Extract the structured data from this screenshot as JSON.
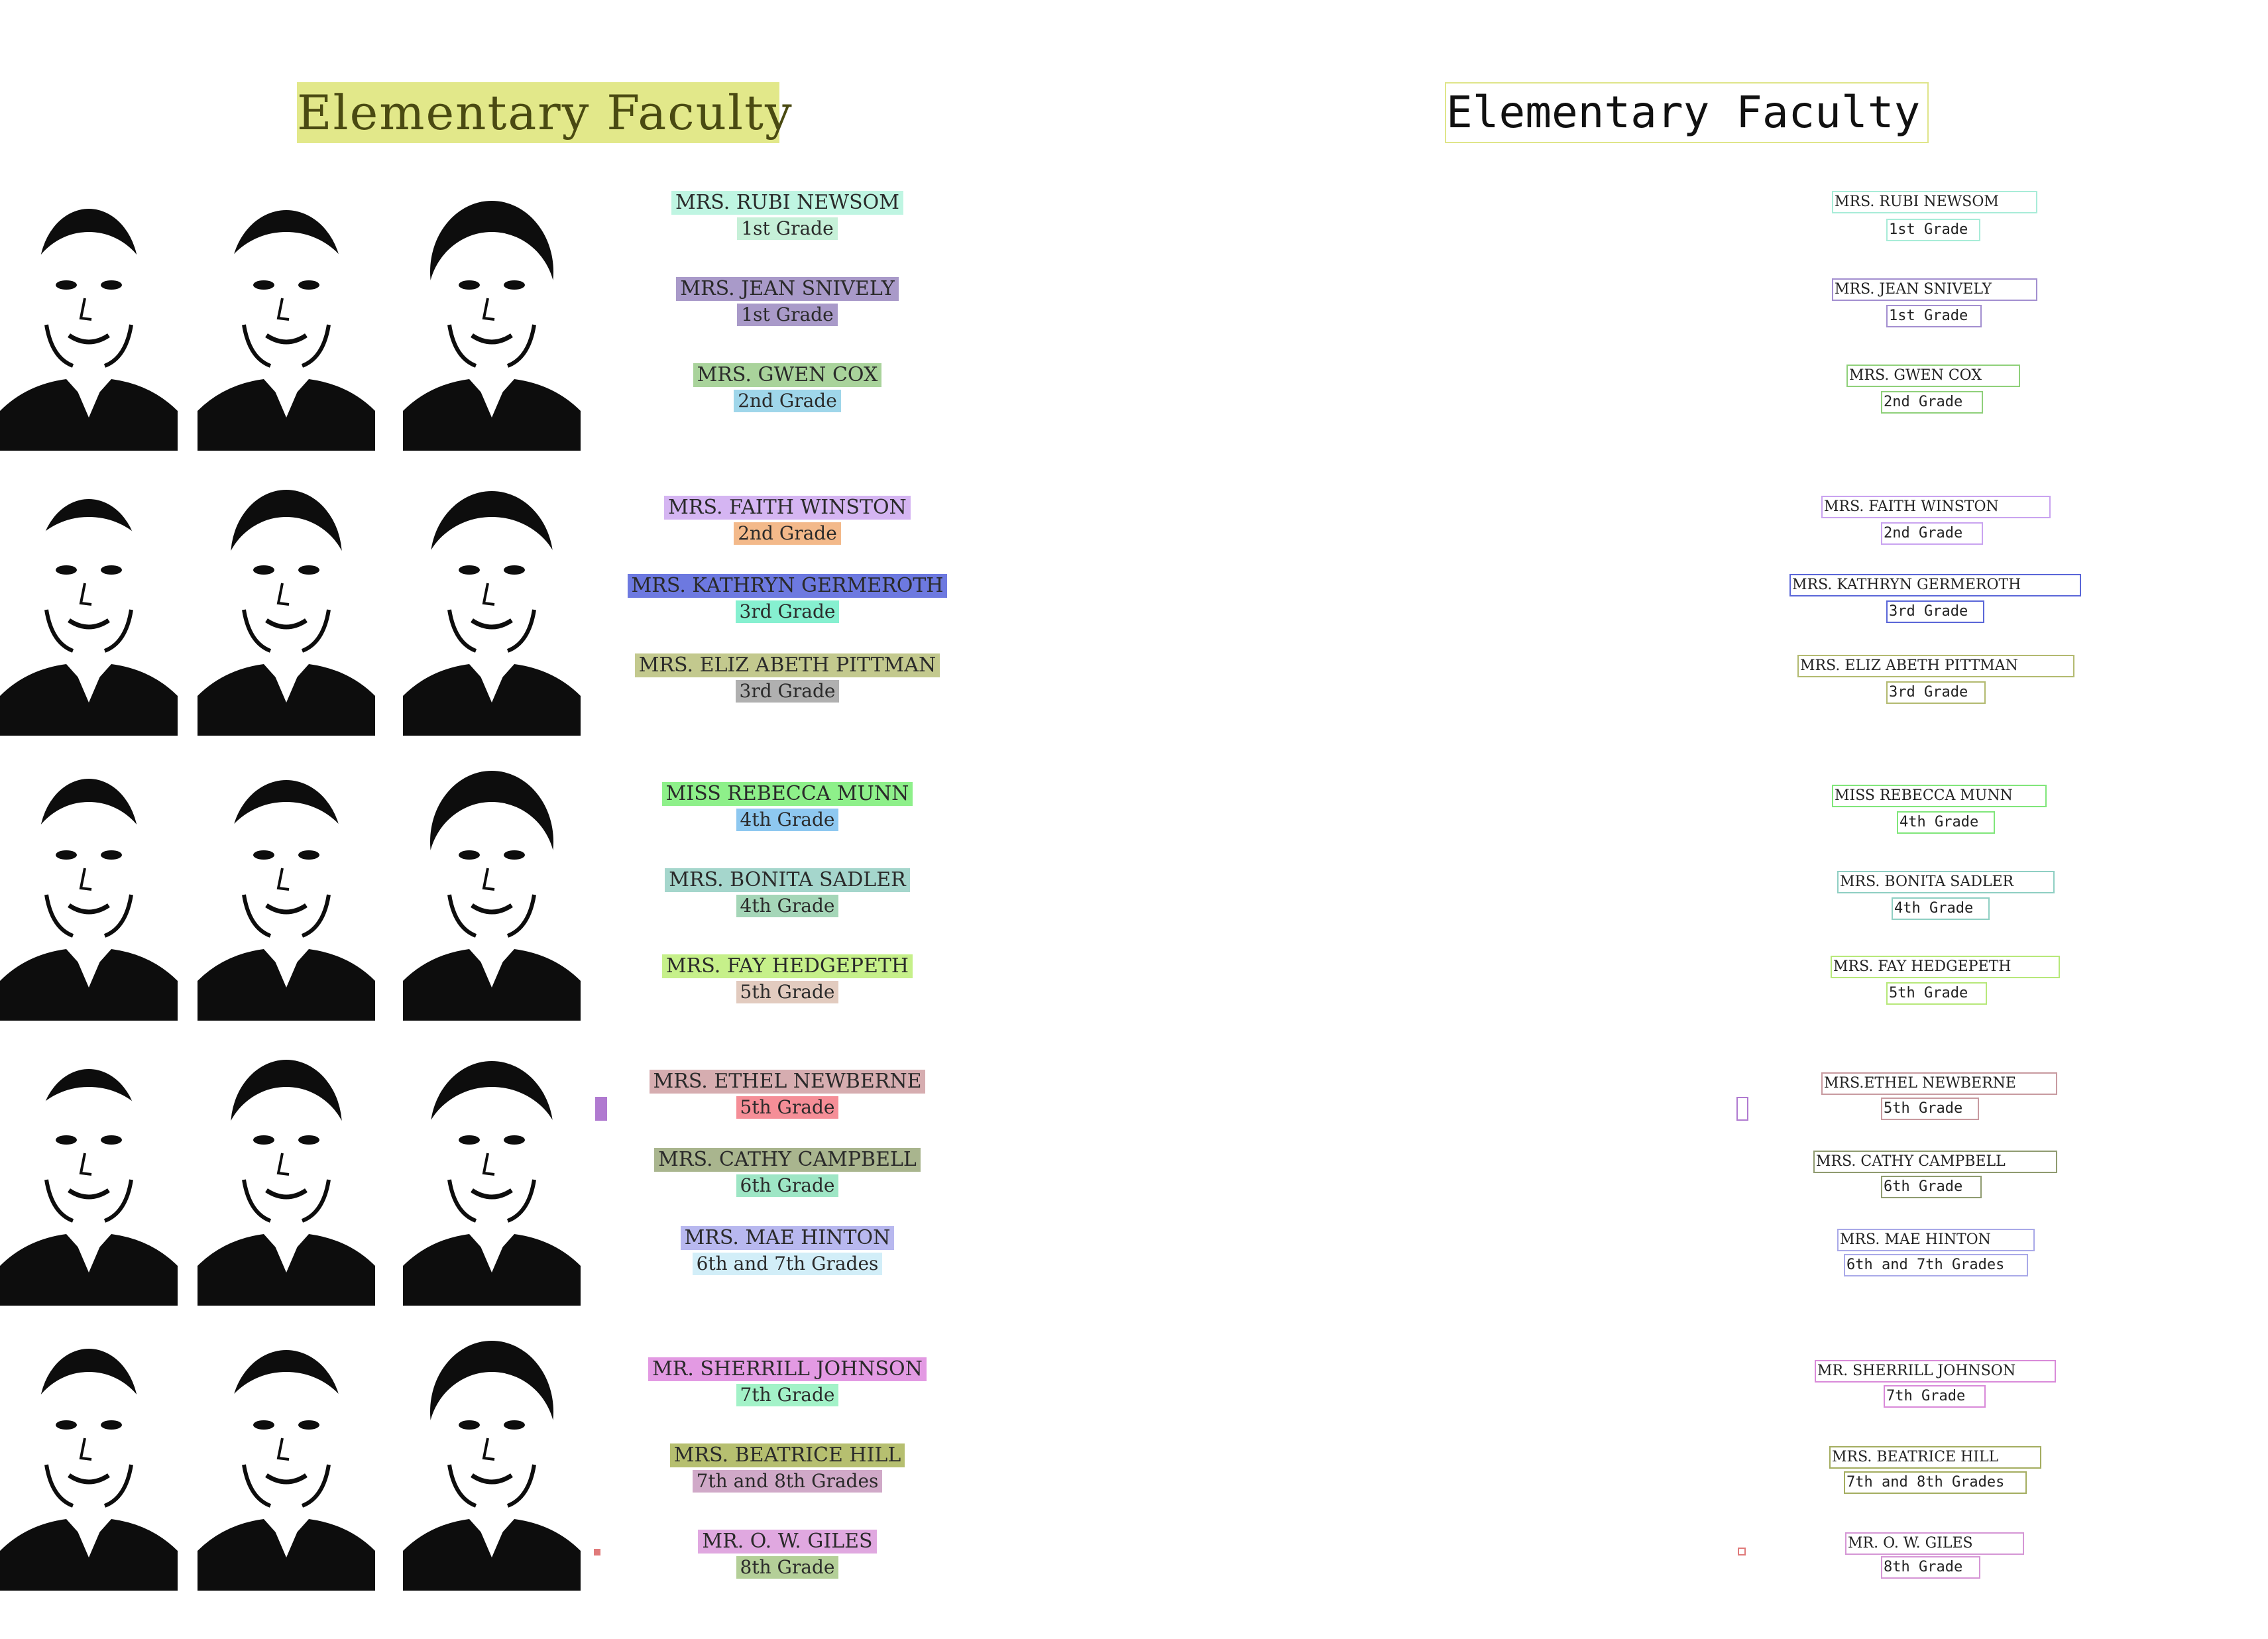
{
  "title": "Elementary Faculty",
  "faculty": [
    {
      "name": "MRS. RUBI NEWSOM",
      "grade": "1st Grade",
      "name_color": "#bff5e2",
      "grade_color": "#c6f0d8"
    },
    {
      "name": "MRS. JEAN SNIVELY",
      "grade": "1st Grade",
      "name_color": "#a99ac9",
      "grade_color": "#a99ac9"
    },
    {
      "name": "MRS. GWEN COX",
      "grade": "2nd Grade",
      "name_color": "#a9d39b",
      "grade_color": "#9fd6ea"
    },
    {
      "name": "MRS. FAITH WINSTON",
      "grade": "2nd Grade",
      "name_color": "#d5b5f2",
      "grade_color": "#f3b98a"
    },
    {
      "name": "MRS. KATHRYN GERMEROTH",
      "grade": "3rd Grade",
      "name_color": "#6d79e0",
      "grade_color": "#86f0d0"
    },
    {
      "name": "MRS. ELIZ ABETH PITTMAN",
      "grade": "3rd Grade",
      "name_color": "#c3c98e",
      "grade_color": "#b0b0b0"
    },
    {
      "name": "MISS REBECCA MUNN",
      "grade": "4th Grade",
      "name_color": "#8ef08a",
      "grade_color": "#8ec8f0"
    },
    {
      "name": "MRS. BONITA SADLER",
      "grade": "4th Grade",
      "name_color": "#a5d6cc",
      "grade_color": "#a5d6b8"
    },
    {
      "name": "MRS. FAY HEDGEPETH",
      "grade": "5th Grade",
      "name_color": "#c6f08a",
      "grade_color": "#e2cbbf"
    },
    {
      "name": "MRS. ETHEL NEWBERNE",
      "grade": "5th Grade",
      "name_color": "#d6adb0",
      "grade_color": "#f58e97"
    },
    {
      "name": "MRS. CATHY CAMPBELL",
      "grade": "6th Grade",
      "name_color": "#a9b58e",
      "grade_color": "#9ee6c5"
    },
    {
      "name": "MRS. MAE HINTON",
      "grade": "6th and 7th Grades",
      "name_color": "#b8b8ef",
      "grade_color": "#d2eef8"
    },
    {
      "name": "MR. SHERRILL JOHNSON",
      "grade": "7th Grade",
      "name_color": "#e39ae3",
      "grade_color": "#a3f2c8"
    },
    {
      "name": "MRS. BEATRICE HILL",
      "grade": "7th and 8th Grades",
      "name_color": "#b6bf70",
      "grade_color": "#d0a9c8"
    },
    {
      "name": "MR. O. W. GILES",
      "grade": "8th Grade",
      "name_color": "#e0a8e0",
      "grade_color": "#b4cf98"
    }
  ],
  "right_faculty": [
    {
      "name": "MRS. RUBI NEWSOM",
      "grade": "1st Grade",
      "color": "#a8ecd8"
    },
    {
      "name": "MRS. JEAN SNIVELY",
      "grade": "1st Grade",
      "color": "#a38fd0"
    },
    {
      "name": "MRS. GWEN COX",
      "grade": "2nd Grade",
      "color": "#8fd07a"
    },
    {
      "name": "MRS. FAITH WINSTON",
      "grade": "2nd Grade",
      "color": "#c9a3f0"
    },
    {
      "name": "MRS. KATHRYN GERMEROTH",
      "grade": "3rd Grade",
      "color": "#5a66d8"
    },
    {
      "name": "MRS. ELIZ ABETH PITTMAN",
      "grade": "3rd Grade",
      "color": "#b3ba70"
    },
    {
      "name": "MISS REBECCA MUNN",
      "grade": "4th Grade",
      "color": "#80e67a"
    },
    {
      "name": "MRS. BONITA SADLER",
      "grade": "4th Grade",
      "color": "#8fcfc3"
    },
    {
      "name": "MRS. FAY HEDGEPETH",
      "grade": "5th Grade",
      "color": "#b7e87a"
    },
    {
      "name": "MRS.ETHEL NEWBERNE",
      "grade": "5th Grade",
      "color": "#c89aa0"
    },
    {
      "name": "MRS. CATHY CAMPBELL",
      "grade": "6th Grade",
      "color": "#8f9b70"
    },
    {
      "name": "MRS. MAE HINTON",
      "grade": "6th and 7th Grades",
      "color": "#a9a9e8"
    },
    {
      "name": "MR. SHERRILL JOHNSON",
      "grade": "7th Grade",
      "color": "#d98ad9"
    },
    {
      "name": "MRS. BEATRICE HILL",
      "grade": "7th and 8th Grades",
      "color": "#a4ad60"
    },
    {
      "name": "MR. O. W. GILES",
      "grade": "8th Grade",
      "color": "#d596d5"
    }
  ],
  "colors": {
    "title_highlight": "#e2e88a",
    "title_box": "#dfe58a",
    "photo_ink": "#0d0d0d",
    "page_background": "#ffffff"
  }
}
